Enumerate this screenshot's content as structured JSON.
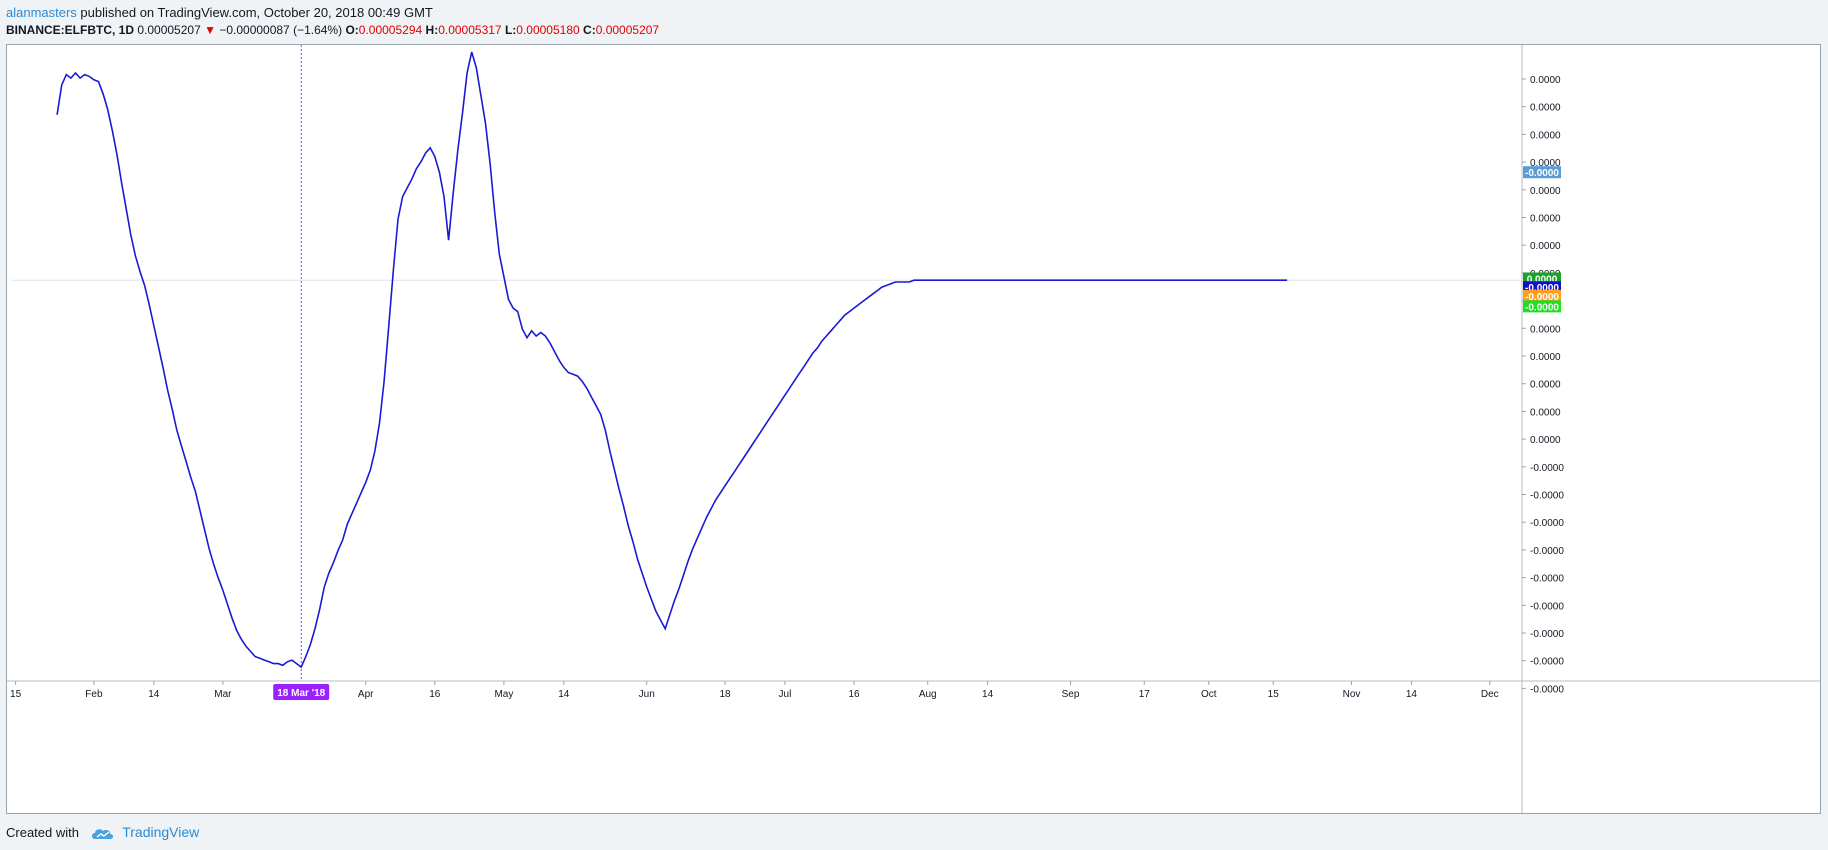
{
  "header": {
    "author": "alanmasters",
    "published": " published on TradingView.com, October 20, 2018 00:49 GMT",
    "symbol": "BINANCE:ELFBTC, 1D",
    "price": "0.00005207",
    "change_arrow": "▼",
    "change": "−0.00000087 (−1.64%)",
    "o_label": "O:",
    "o_value": "0.00005294",
    "h_label": "H:",
    "h_value": "0.00005317",
    "l_label": "L:",
    "l_value": "0.00005180",
    "c_label": "C:",
    "c_value": "0.00005207"
  },
  "footer": {
    "created_with": "Created with",
    "brand": "TradingView",
    "logo_icon": "tradingview-cloud-icon"
  },
  "chart_data": {
    "type": "line",
    "x_tick_labels": [
      {
        "label": "15",
        "day": 0
      },
      {
        "label": "Feb",
        "day": 17
      },
      {
        "label": "14",
        "day": 30
      },
      {
        "label": "Mar",
        "day": 45
      },
      {
        "label": "Apr",
        "day": 76
      },
      {
        "label": "16",
        "day": 91
      },
      {
        "label": "May",
        "day": 106
      },
      {
        "label": "14",
        "day": 119
      },
      {
        "label": "Jun",
        "day": 137
      },
      {
        "label": "18",
        "day": 154
      },
      {
        "label": "Jul",
        "day": 167
      },
      {
        "label": "16",
        "day": 182
      },
      {
        "label": "Aug",
        "day": 198
      },
      {
        "label": "14",
        "day": 211
      },
      {
        "label": "Sep",
        "day": 229
      },
      {
        "label": "17",
        "day": 245
      },
      {
        "label": "Oct",
        "day": 259
      },
      {
        "label": "15",
        "day": 273
      },
      {
        "label": "Nov",
        "day": 290
      },
      {
        "label": "14",
        "day": 303
      },
      {
        "label": "Dec",
        "day": 320
      }
    ],
    "crosshair": {
      "label": "18 Mar '18",
      "day": 62
    },
    "y_tick_labels": [
      "0.0000",
      "0.0000",
      "0.0000",
      "0.0000",
      "0.0000",
      "0.0000",
      "0.0000",
      "0.0000",
      "0.0000",
      "0.0000",
      "0.0000",
      "0.0000",
      "0.0000",
      "0.0000",
      "-0.0000",
      "-0.0000",
      "-0.0000",
      "-0.0000",
      "-0.0000",
      "-0.0000",
      "-0.0000",
      "-0.0000",
      "-0.0000"
    ],
    "ylim": [
      -23,
      13.5
    ],
    "series_badges": [
      {
        "text": "-0.0000",
        "value": 6.2,
        "color": "#5b9bd5"
      },
      {
        "text": "0.0000",
        "value": 0.1,
        "color": "#18a32a"
      },
      {
        "text": "-0.0000",
        "value": -0.4,
        "color": "#1111cc"
      },
      {
        "text": "-0.0000",
        "value": -0.9,
        "color": "#ff9e1f"
      },
      {
        "text": "-0.0000",
        "value": -1.5,
        "color": "#22dd22"
      }
    ],
    "series": [
      {
        "color": "#1a1ad6",
        "points": [
          [
            9,
            9.5
          ],
          [
            10,
            11.2
          ],
          [
            11,
            11.8
          ],
          [
            12,
            11.6
          ],
          [
            13,
            11.9
          ],
          [
            14,
            11.6
          ],
          [
            15,
            11.8
          ],
          [
            16,
            11.7
          ],
          [
            17,
            11.5
          ],
          [
            18,
            11.4
          ],
          [
            19,
            10.7
          ],
          [
            20,
            9.8
          ],
          [
            21,
            8.6
          ],
          [
            22,
            7.2
          ],
          [
            23,
            5.6
          ],
          [
            24,
            4.1
          ],
          [
            25,
            2.6
          ],
          [
            26,
            1.4
          ],
          [
            27,
            0.5
          ],
          [
            28,
            -0.3
          ],
          [
            29,
            -1.4
          ],
          [
            30,
            -2.6
          ],
          [
            31,
            -3.8
          ],
          [
            32,
            -5.0
          ],
          [
            33,
            -6.3
          ],
          [
            34,
            -7.4
          ],
          [
            35,
            -8.6
          ],
          [
            36,
            -9.5
          ],
          [
            37,
            -10.4
          ],
          [
            38,
            -11.3
          ],
          [
            39,
            -12.1
          ],
          [
            40,
            -13.2
          ],
          [
            41,
            -14.3
          ],
          [
            42,
            -15.4
          ],
          [
            43,
            -16.3
          ],
          [
            44,
            -17.1
          ],
          [
            45,
            -17.8
          ],
          [
            46,
            -18.6
          ],
          [
            47,
            -19.4
          ],
          [
            48,
            -20.1
          ],
          [
            49,
            -20.6
          ],
          [
            50,
            -21.0
          ],
          [
            51,
            -21.3
          ],
          [
            52,
            -21.6
          ],
          [
            53,
            -21.7
          ],
          [
            54,
            -21.8
          ],
          [
            55,
            -21.9
          ],
          [
            56,
            -22.0
          ],
          [
            57,
            -22.0
          ],
          [
            58,
            -22.1
          ],
          [
            59,
            -21.9
          ],
          [
            60,
            -21.8
          ],
          [
            61,
            -22.0
          ],
          [
            62,
            -22.2
          ],
          [
            63,
            -21.6
          ],
          [
            64,
            -20.9
          ],
          [
            65,
            -20.0
          ],
          [
            66,
            -18.9
          ],
          [
            67,
            -17.6
          ],
          [
            68,
            -16.8
          ],
          [
            69,
            -16.2
          ],
          [
            70,
            -15.5
          ],
          [
            71,
            -14.9
          ],
          [
            72,
            -14.0
          ],
          [
            73,
            -13.4
          ],
          [
            74,
            -12.8
          ],
          [
            75,
            -12.2
          ],
          [
            76,
            -11.6
          ],
          [
            77,
            -10.9
          ],
          [
            78,
            -9.8
          ],
          [
            79,
            -8.2
          ],
          [
            80,
            -5.8
          ],
          [
            81,
            -2.6
          ],
          [
            82,
            0.6
          ],
          [
            83,
            3.5
          ],
          [
            84,
            4.8
          ],
          [
            85,
            5.3
          ],
          [
            86,
            5.8
          ],
          [
            87,
            6.4
          ],
          [
            88,
            6.8
          ],
          [
            89,
            7.3
          ],
          [
            90,
            7.6
          ],
          [
            91,
            7.1
          ],
          [
            92,
            6.2
          ],
          [
            93,
            4.8
          ],
          [
            94,
            2.3
          ],
          [
            95,
            5.0
          ],
          [
            96,
            7.5
          ],
          [
            97,
            9.6
          ],
          [
            98,
            11.9
          ],
          [
            99,
            13.1
          ],
          [
            100,
            12.2
          ],
          [
            101,
            10.6
          ],
          [
            102,
            9.0
          ],
          [
            103,
            6.7
          ],
          [
            104,
            3.9
          ],
          [
            105,
            1.5
          ],
          [
            106,
            0.2
          ],
          [
            107,
            -1.1
          ],
          [
            108,
            -1.6
          ],
          [
            109,
            -1.8
          ],
          [
            110,
            -2.8
          ],
          [
            111,
            -3.3
          ],
          [
            112,
            -2.9
          ],
          [
            113,
            -3.2
          ],
          [
            114,
            -3.0
          ],
          [
            115,
            -3.2
          ],
          [
            116,
            -3.6
          ],
          [
            117,
            -4.1
          ],
          [
            118,
            -4.6
          ],
          [
            119,
            -5.0
          ],
          [
            120,
            -5.3
          ],
          [
            121,
            -5.4
          ],
          [
            122,
            -5.5
          ],
          [
            123,
            -5.8
          ],
          [
            124,
            -6.2
          ],
          [
            125,
            -6.7
          ],
          [
            126,
            -7.2
          ],
          [
            127,
            -7.7
          ],
          [
            128,
            -8.6
          ],
          [
            129,
            -9.8
          ],
          [
            130,
            -10.9
          ],
          [
            131,
            -12.0
          ],
          [
            132,
            -13.0
          ],
          [
            133,
            -14.1
          ],
          [
            134,
            -15.0
          ],
          [
            135,
            -16.0
          ],
          [
            136,
            -16.8
          ],
          [
            137,
            -17.6
          ],
          [
            138,
            -18.3
          ],
          [
            139,
            -19.0
          ],
          [
            140,
            -19.5
          ],
          [
            141,
            -20.0
          ],
          [
            142,
            -19.2
          ],
          [
            143,
            -18.4
          ],
          [
            144,
            -17.7
          ],
          [
            145,
            -16.9
          ],
          [
            146,
            -16.1
          ],
          [
            147,
            -15.4
          ],
          [
            148,
            -14.8
          ],
          [
            149,
            -14.2
          ],
          [
            150,
            -13.6
          ],
          [
            151,
            -13.1
          ],
          [
            152,
            -12.6
          ],
          [
            153,
            -12.2
          ],
          [
            154,
            -11.8
          ],
          [
            155,
            -11.4
          ],
          [
            156,
            -11.0
          ],
          [
            157,
            -10.6
          ],
          [
            158,
            -10.2
          ],
          [
            159,
            -9.8
          ],
          [
            160,
            -9.4
          ],
          [
            161,
            -9.0
          ],
          [
            162,
            -8.6
          ],
          [
            163,
            -8.2
          ],
          [
            164,
            -7.8
          ],
          [
            165,
            -7.4
          ],
          [
            166,
            -7.0
          ],
          [
            167,
            -6.6
          ],
          [
            168,
            -6.2
          ],
          [
            169,
            -5.8
          ],
          [
            170,
            -5.4
          ],
          [
            171,
            -5.0
          ],
          [
            172,
            -4.6
          ],
          [
            173,
            -4.2
          ],
          [
            174,
            -3.9
          ],
          [
            175,
            -3.5
          ],
          [
            176,
            -3.2
          ],
          [
            177,
            -2.9
          ],
          [
            178,
            -2.6
          ],
          [
            179,
            -2.3
          ],
          [
            180,
            -2.0
          ],
          [
            181,
            -1.8
          ],
          [
            182,
            -1.6
          ],
          [
            183,
            -1.4
          ],
          [
            184,
            -1.2
          ],
          [
            185,
            -1.0
          ],
          [
            186,
            -0.8
          ],
          [
            187,
            -0.6
          ],
          [
            188,
            -0.4
          ],
          [
            189,
            -0.3
          ],
          [
            190,
            -0.2
          ],
          [
            191,
            -0.1
          ],
          [
            192,
            -0.1
          ],
          [
            193,
            -0.1
          ],
          [
            194,
            -0.1
          ],
          [
            195,
            0.0
          ],
          [
            196,
            0.0
          ],
          [
            197,
            0.0
          ],
          [
            198,
            0.0
          ],
          [
            199,
            0.0
          ],
          [
            200,
            0.0
          ],
          [
            201,
            0.0
          ],
          [
            202,
            0.0
          ],
          [
            203,
            0.0
          ],
          [
            204,
            0.0
          ],
          [
            205,
            0.0
          ],
          [
            206,
            0.0
          ],
          [
            207,
            0.0
          ],
          [
            208,
            0.0
          ],
          [
            209,
            0.0
          ],
          [
            210,
            0.0
          ],
          [
            211,
            0.0
          ],
          [
            212,
            0.0
          ],
          [
            213,
            0.0
          ],
          [
            214,
            0.0
          ],
          [
            215,
            0.0
          ],
          [
            216,
            0.0
          ],
          [
            217,
            0.0
          ],
          [
            218,
            0.0
          ],
          [
            219,
            0.0
          ],
          [
            220,
            0.0
          ],
          [
            221,
            0.0
          ],
          [
            222,
            0.0
          ],
          [
            223,
            0.0
          ],
          [
            224,
            0.0
          ],
          [
            225,
            0.0
          ],
          [
            226,
            0.0
          ],
          [
            227,
            0.0
          ],
          [
            228,
            0.0
          ],
          [
            229,
            0.0
          ],
          [
            230,
            0.0
          ],
          [
            231,
            0.0
          ],
          [
            232,
            0.0
          ],
          [
            233,
            0.0
          ],
          [
            234,
            0.0
          ],
          [
            235,
            0.0
          ],
          [
            236,
            0.0
          ],
          [
            237,
            0.0
          ],
          [
            238,
            0.0
          ],
          [
            239,
            0.0
          ],
          [
            240,
            0.0
          ],
          [
            241,
            0.0
          ],
          [
            242,
            0.0
          ],
          [
            243,
            0.0
          ],
          [
            244,
            0.0
          ],
          [
            245,
            0.0
          ],
          [
            246,
            0.0
          ],
          [
            247,
            0.0
          ],
          [
            248,
            0.0
          ],
          [
            249,
            0.0
          ],
          [
            250,
            0.0
          ],
          [
            251,
            0.0
          ],
          [
            252,
            0.0
          ],
          [
            253,
            0.0
          ],
          [
            254,
            0.0
          ],
          [
            255,
            0.0
          ],
          [
            256,
            0.0
          ],
          [
            257,
            0.0
          ],
          [
            258,
            0.0
          ],
          [
            259,
            0.0
          ],
          [
            260,
            0.0
          ],
          [
            261,
            0.0
          ],
          [
            262,
            0.0
          ],
          [
            263,
            0.0
          ],
          [
            264,
            0.0
          ],
          [
            265,
            0.0
          ],
          [
            266,
            0.0
          ],
          [
            267,
            0.0
          ],
          [
            268,
            0.0
          ],
          [
            269,
            0.0
          ],
          [
            270,
            0.0
          ],
          [
            271,
            0.0
          ],
          [
            272,
            0.0
          ],
          [
            273,
            0.0
          ],
          [
            274,
            0.0
          ],
          [
            275,
            0.0
          ],
          [
            276,
            0.0
          ]
        ]
      }
    ]
  }
}
